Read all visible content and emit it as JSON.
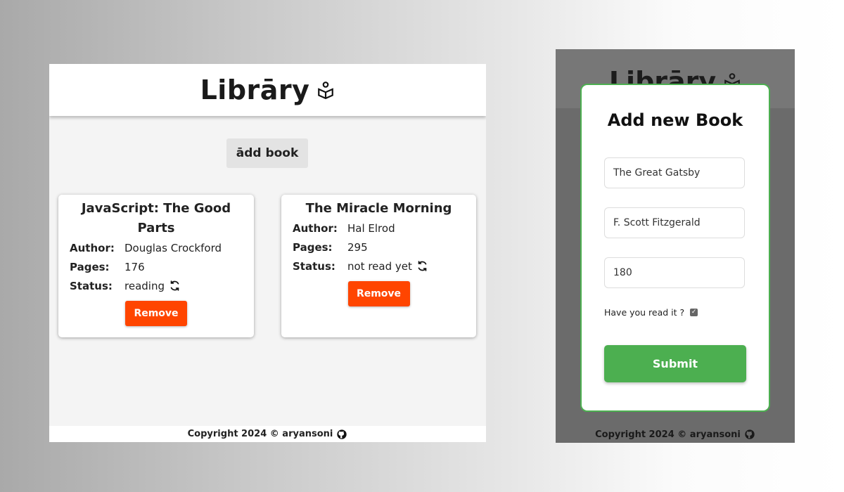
{
  "app": {
    "title": "Librāry"
  },
  "toolbar": {
    "add_book_label": "ādd book"
  },
  "books": [
    {
      "title": "JavaScript: The Good Parts",
      "author_label": "Author:",
      "author": "Douglas Crockford",
      "pages_label": "Pages:",
      "pages": "176",
      "status_label": "Status:",
      "status": "reading",
      "remove_label": "Remove"
    },
    {
      "title": "The Miracle Morning",
      "author_label": "Author:",
      "author": "Hal Elrod",
      "pages_label": "Pages:",
      "pages": "295",
      "status_label": "Status:",
      "status": "not read yet",
      "remove_label": "Remove"
    }
  ],
  "footer": {
    "text": "Copyright 2024 © aryansoni"
  },
  "modal": {
    "title": "Add new Book",
    "title_value": "The Great Gatsby",
    "author_value": "F. Scott Fitzgerald",
    "pages_value": "180",
    "read_label": "Have you read it ?",
    "read_checked": true,
    "submit_label": "Submit"
  },
  "icons": {
    "logo": "book-reader-icon",
    "status": "sync-icon",
    "footer": "github-icon"
  },
  "colors": {
    "remove": "#ff4500",
    "submit": "#4caf50",
    "modal_border": "#4caf50"
  }
}
